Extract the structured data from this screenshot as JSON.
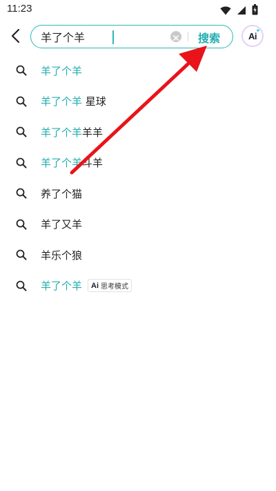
{
  "status_bar": {
    "time": "11:23",
    "icons": [
      "wifi-icon",
      "signal-icon",
      "battery-icon"
    ]
  },
  "search": {
    "query": "羊了个羊",
    "submit_label": "搜索",
    "ai_label": "Ai"
  },
  "suggestions": [
    {
      "highlight": "羊了个羊",
      "rest": "",
      "badge": ""
    },
    {
      "highlight": "羊了个羊",
      "rest": " 星球",
      "badge": ""
    },
    {
      "highlight": "羊了个羊",
      "rest": "羊羊",
      "badge": ""
    },
    {
      "highlight": "羊了个羊",
      "rest": "斗羊",
      "badge": ""
    },
    {
      "highlight": "",
      "rest": "养了个猫",
      "badge": ""
    },
    {
      "highlight": "",
      "rest": "羊了又羊",
      "badge": ""
    },
    {
      "highlight": "",
      "rest": "羊乐个狼",
      "badge": ""
    },
    {
      "highlight": "羊了个羊",
      "rest": "",
      "badge": {
        "icon": "Ai",
        "label": "思考模式"
      }
    }
  ],
  "colors": {
    "accent": "#23aeb0",
    "search_border": "#2bb7b5",
    "annotation_arrow": "#e8141a"
  }
}
